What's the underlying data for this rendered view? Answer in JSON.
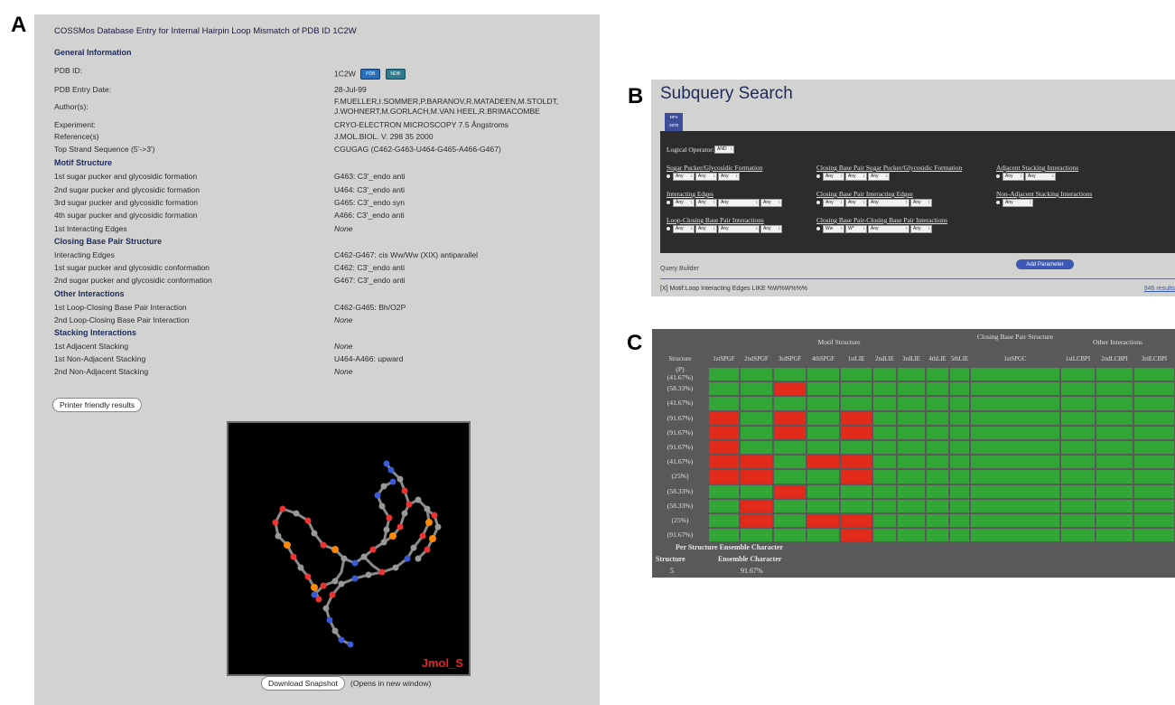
{
  "panel_labels": {
    "a": "A",
    "b": "B",
    "c": "C"
  },
  "panelA": {
    "title": "COSSMos Database Entry for Internal Hairpin Loop Mismatch of PDB ID 1C2W",
    "sections": {
      "general": "General Information",
      "motif": "Motif Structure",
      "closing": "Closing Base Pair Structure",
      "other": "Other Interactions",
      "stacking": "Stacking Interactions"
    },
    "rows": [
      {
        "label": "PDB ID:",
        "value": "1C2W"
      },
      {
        "label": "PDB Entry Date:",
        "value": "28-Jul-99"
      },
      {
        "label": "Author(s):",
        "value": "F.MUELLER,I.SOMMER,P.BARANOV,R.MATADEEN,M.STOLDT, J.WOHNERT,M.GORLACH,M.VAN HEEL,R.BRIMACOMBE"
      },
      {
        "label": "Experiment:",
        "value": "CRYO-ELECTRON MICROSCOPY 7.5 Ångstroms"
      },
      {
        "label": "Reference(s)",
        "value": "J.MOL.BIOL. V. 298 35 2000"
      },
      {
        "label": "Top Strand Sequence (5'->3')",
        "value": "CGUGAG (C462-G463-U464-G465-A466-G467)"
      },
      {
        "label": "1st sugar pucker and glycosidic formation",
        "value": "G463: C3'_endo anti"
      },
      {
        "label": "2nd sugar pucker and glycosidic formation",
        "value": "U464: C3'_endo anti"
      },
      {
        "label": "3rd sugar pucker and glycosidic formation",
        "value": "G465: C3'_endo syn"
      },
      {
        "label": "4th sugar pucker and glycosidic formation",
        "value": "A466: C3'_endo anti"
      },
      {
        "label": "1st Interacting Edges",
        "value": "None"
      },
      {
        "label": "Interacting Edges",
        "value": "C462-G467: cis Ww/Ww (XIX) antiparallel"
      },
      {
        "label": "1st sugar pucker and glycosidic conformation",
        "value": "C462: C3'_endo anti"
      },
      {
        "label": "2nd sugar pucker and glycosidic conformation",
        "value": "G467: C3'_endo anti"
      },
      {
        "label": "1st Loop-Closing Base Pair Interaction",
        "value": "C462-G465: Bh/O2P"
      },
      {
        "label": "2nd Loop-Closing Base Pair Interaction",
        "value": "None"
      },
      {
        "label": "1st Adjacent Stacking",
        "value": "None"
      },
      {
        "label": "1st Non-Adjacent Stacking",
        "value": "U464-A466: upward"
      },
      {
        "label": "2nd Non-Adjacent Stacking",
        "value": "None"
      }
    ],
    "pdb_buttons": [
      "PDB",
      "NDB"
    ],
    "printer_button": "Printer friendly results",
    "jmol_label": "Jmol_S",
    "download_button": "Download Snapshot",
    "download_note": "(Opens in new window)"
  },
  "panelB": {
    "title": "Subquery Search",
    "tab": {
      "line1": "NP4",
      "line2": "2878"
    },
    "logical_operator_label": "Logical Operator:",
    "logical_operator_value": "AND",
    "links": [
      "Sugar Pucker/Glycosidic Formation",
      "Interacting Edges",
      "Loop-Closing Base Pair Interactions",
      "Closing Base Pair Sugar Pucker/Glycosidic Formation",
      "Closing Base Pair Interacting Edges",
      "Closing Base Pair-Closing Base Pair Interactions",
      "Adjacent Stacking Interactions",
      "Non-Adjacent Stacking Interactions"
    ],
    "any": "Any",
    "ww": "Ww",
    "w_star": "W*",
    "add_button": "Add Parameter",
    "query_builder": "Query Builder",
    "query_text": "[X] Motif:Loop Interacting Edges LIKE %W%W%%%",
    "results_link": "946 results"
  },
  "panelC": {
    "group_headers": [
      "Motif Structure",
      "Closing Base Pair Structure",
      "Other Interactions"
    ],
    "columns": [
      "Structure",
      "1stSPGF",
      "2ndSPGF",
      "3rdSPGF",
      "4thSPGF",
      "1stLIE",
      "2ndLIE",
      "3rdLIE",
      "4thLIE",
      "5thLIE",
      "1stSPGC",
      "1stLCBPI",
      "2ndLCBPI",
      "3rdLCBPI"
    ],
    "status_colors": {
      "match": "#33a537",
      "mismatch": "#e02b1c"
    },
    "rows": [
      {
        "label": "(P)\n(41.67%)",
        "cells": "gggggggggggggg"
      },
      {
        "label": "(58.33%)",
        "cells": "gggrgggggggggg"
      },
      {
        "label": "(41.67%)",
        "cells": "gggggggggggggg"
      },
      {
        "label": "(91.67%)",
        "cells": "grgrgrgggggggg"
      },
      {
        "label": "(91.67%)",
        "cells": "grgrgrgggggggg"
      },
      {
        "label": "(91.67%)",
        "cells": "rrgggggggggggg"
      },
      {
        "label": "(41.67%)",
        "cells": "rrrgrrgggggggg"
      },
      {
        "label": "(25%)",
        "cells": "grrggrgggggggg"
      },
      {
        "label": "(58.33%)",
        "cells": "gggrgggggggggg"
      },
      {
        "label": "(58.33%)",
        "cells": "ggrggggggggggg"
      },
      {
        "label": "(25%)",
        "cells": "rgrgrrgggggggg"
      },
      {
        "label": "(91.67%)",
        "cells": "rggggrgggggggg"
      }
    ],
    "footer": {
      "title": "Per Structure Ensemble Character",
      "col1": "Structure",
      "col2": "Ensemble Character",
      "val1": "5",
      "val2": "91.67%"
    }
  }
}
